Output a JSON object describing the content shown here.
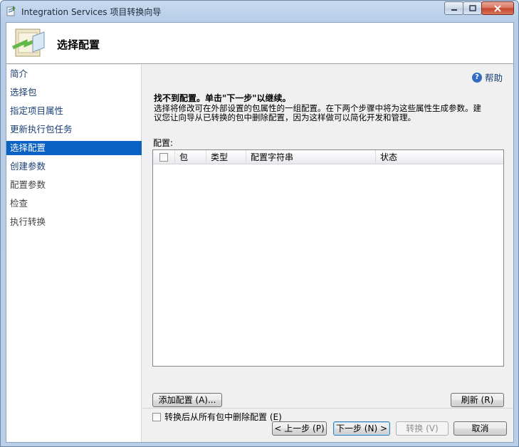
{
  "window": {
    "title": "Integration Services 项目转换向导"
  },
  "header": {
    "title": "选择配置"
  },
  "nav": {
    "items": [
      {
        "label": "简介",
        "state": "link"
      },
      {
        "label": "选择包",
        "state": "link"
      },
      {
        "label": "指定项目属性",
        "state": "link"
      },
      {
        "label": "更新执行包任务",
        "state": "link"
      },
      {
        "label": "选择配置",
        "state": "selected"
      },
      {
        "label": "创建参数",
        "state": "link"
      },
      {
        "label": "配置参数",
        "state": "disabled"
      },
      {
        "label": "检查",
        "state": "disabled"
      },
      {
        "label": "执行转换",
        "state": "disabled"
      }
    ]
  },
  "help": {
    "label": "帮助"
  },
  "message": {
    "title": "找不到配置。单击\"下一步\"以继续。",
    "body_line1": "选择将修改可在外部设置的包属性的一组配置。在下两个步骤中将为这些属性生成参数。建",
    "body_line2": "议您让向导从已转换的包中删除配置，因为这样做可以简化开发和管理。"
  },
  "config_list": {
    "label": "配置:",
    "columns": [
      "包",
      "类型",
      "配置字符串",
      "状态"
    ],
    "rows": []
  },
  "buttons": {
    "add_config": "添加配置 (A)...",
    "refresh": "刷新 (R)",
    "back": "< 上一步 (P)",
    "next": "下一步 (N) >",
    "convert": "转换 (V)",
    "cancel": "取消"
  },
  "remove_checkbox": {
    "label": "转换后从所有包中删除配置 (E)",
    "checked": false
  },
  "colors": {
    "selected_nav": "#0a62c5",
    "link": "#1a3f75"
  }
}
